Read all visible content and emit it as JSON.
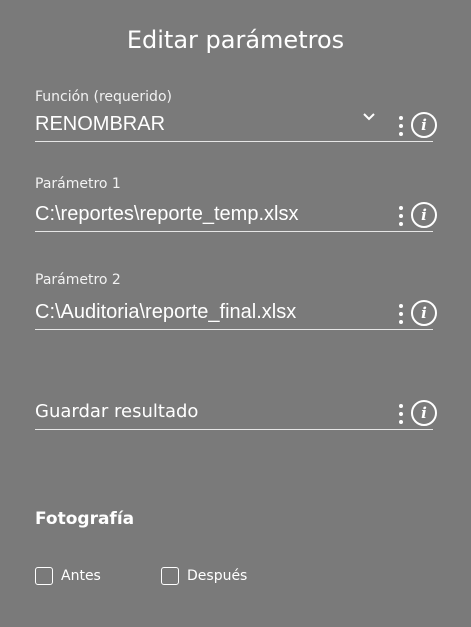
{
  "header": {
    "title": "Editar parámetros"
  },
  "fields": [
    {
      "label": "Función (requerido)",
      "value": "RENOMBRAR",
      "has_dropdown": true
    },
    {
      "label": "Parámetro 1",
      "value": "C:\\reportes\\reporte_temp.xlsx"
    },
    {
      "label": "Parámetro 2",
      "value": "C:\\Auditoria\\reporte_final.xlsx"
    },
    {
      "label": "",
      "value": "Guardar resultado"
    }
  ],
  "screenshot": {
    "title": "Fotografía",
    "options": [
      {
        "label": "Antes",
        "checked": false
      },
      {
        "label": "Después",
        "checked": false
      }
    ]
  },
  "icons": {
    "menu": "kebab-menu-icon",
    "info": "info-icon",
    "dropdown": "chevron-down-icon"
  },
  "colors": {
    "background": "#7a7a7a",
    "text": "#ffffff"
  }
}
